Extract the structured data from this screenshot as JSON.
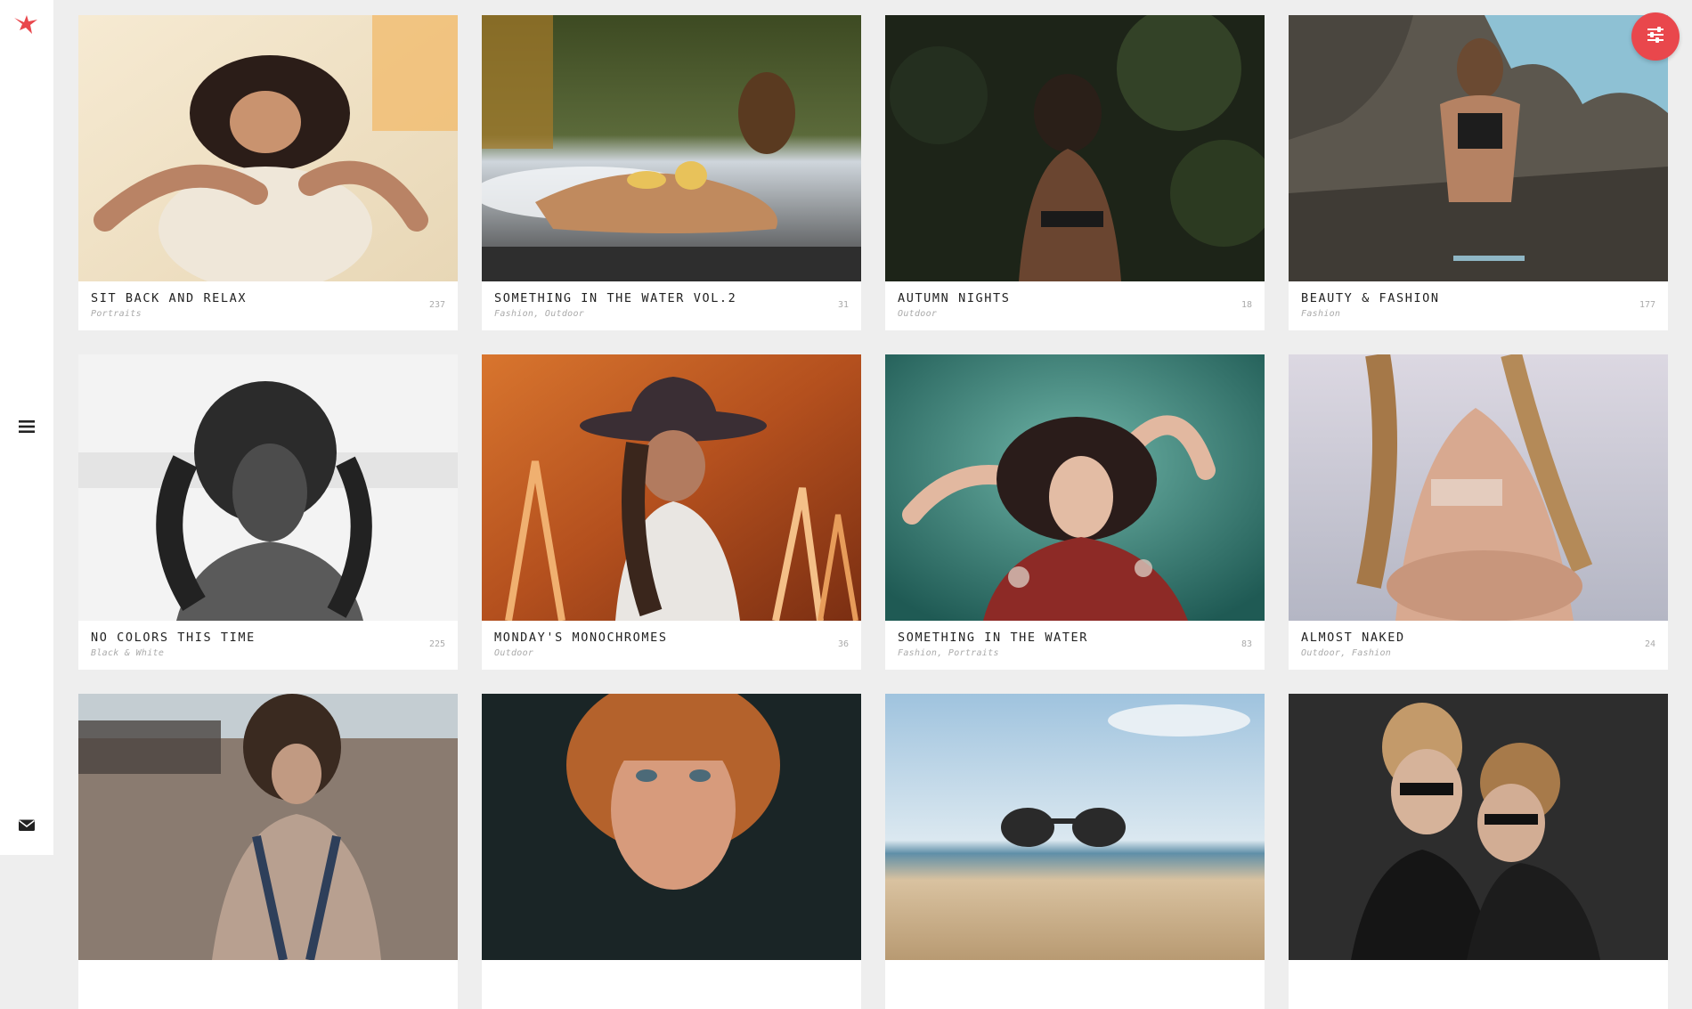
{
  "colors": {
    "accent": "#e9474c",
    "sidebar_bg": "#ffffff",
    "page_bg": "#eeeeee"
  },
  "sidebar": {
    "logo_icon": "bird-logo-icon",
    "menu_icon": "hamburger-menu-icon",
    "contact_icon": "envelope-icon"
  },
  "filter_button": {
    "icon": "sliders-filter-icon"
  },
  "galleries": [
    {
      "title": "SIT BACK AND RELAX",
      "categories": "Portraits",
      "count": "237",
      "palette": "bathtub"
    },
    {
      "title": "SOMETHING IN THE WATER VOL.2",
      "categories": "Fashion, Outdoor",
      "count": "31",
      "palette": "beach-surf"
    },
    {
      "title": "AUTUMN NIGHTS",
      "categories": "Outdoor",
      "count": "18",
      "palette": "dark-forest"
    },
    {
      "title": "BEAUTY & FASHION",
      "categories": "Fashion",
      "count": "177",
      "palette": "rocks-sky"
    },
    {
      "title": "NO COLORS THIS TIME",
      "categories": "Black & White",
      "count": "225",
      "palette": "monochrome"
    },
    {
      "title": "MONDAY'S MONOCHROMES",
      "categories": "Outdoor",
      "count": "36",
      "palette": "orange-field"
    },
    {
      "title": "SOMETHING IN THE WATER",
      "categories": "Fashion, Portraits",
      "count": "83",
      "palette": "teal-water"
    },
    {
      "title": "ALMOST NAKED",
      "categories": "Outdoor, Fashion",
      "count": "24",
      "palette": "soft-sky"
    },
    {
      "title": "",
      "categories": "",
      "count": "",
      "palette": "sandy-beach"
    },
    {
      "title": "",
      "categories": "",
      "count": "",
      "palette": "redhead-dark"
    },
    {
      "title": "",
      "categories": "",
      "count": "",
      "palette": "sunglasses-beach"
    },
    {
      "title": "",
      "categories": "",
      "count": "",
      "palette": "urban-night"
    }
  ]
}
